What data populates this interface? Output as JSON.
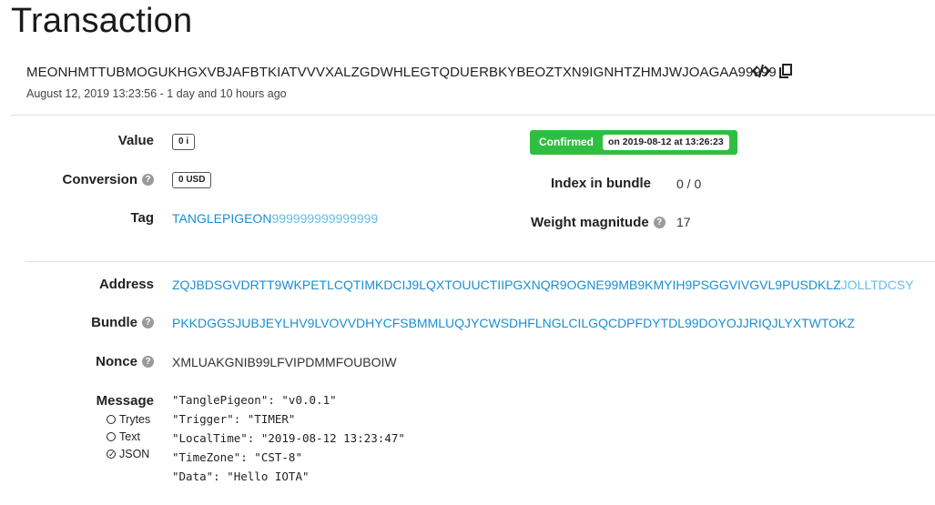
{
  "header": {
    "title": "Transaction",
    "hash": "MEONHMTTUBMOGUKHGXVBJAFBTKIATVVVXALZGDWHLEGTQDUERBKYBEOZTXN9IGNHTZHMJWJOAGAA99999",
    "date": "August 12, 2019 13:23:56 - 1 day and 10 hours ago",
    "icons": [
      "code-icon",
      "copy-icon"
    ]
  },
  "details": {
    "value_label": "Value",
    "value": "0 i",
    "conversion_label": "Conversion",
    "conversion": "0 USD",
    "tag_label": "Tag",
    "tag_main": "TANGLEPIGEON",
    "tag_suffix": "999999999999999",
    "status": "Confirmed",
    "status_time": "on 2019-08-12 at 13:26:23",
    "index_label": "Index in bundle",
    "index": "0 / 0",
    "weight_label": "Weight magnitude",
    "weight": "17"
  },
  "meta": {
    "address_label": "Address",
    "address_main": "ZQJBDSGVDRTT9WKPETLCQTIMKDCIJ9LQXTOUUCTIIPGXNQR9OGNE99MB9KMYIH9PSGGVIVGVL9PUSDKLZ",
    "address_checksum": "JOLLTDCSY",
    "bundle_label": "Bundle",
    "bundle": "PKKDGGSJUBJEYLHV9LVOVVDHYCFSBMMLUQJYCWSDHFLNGLCILGQCDPFDYTDL99DOYOJJRIQJLYXTWTOKZ",
    "nonce_label": "Nonce",
    "nonce": "XMLUAKGNIB99LFVIPDMMFOUBOIW",
    "message_label": "Message",
    "message_formats": [
      "Trytes",
      "Text",
      "JSON"
    ],
    "message_selected": "JSON",
    "message_lines": [
      "\"TanglePigeon\": \"v0.0.1\"",
      "\"Trigger\": \"TIMER\"",
      "\"LocalTime\": \"2019-08-12 13:23:47\"",
      "\"TimeZone\": \"CST-8\"",
      "\"Data\": \"Hello IOTA\""
    ]
  },
  "colors": {
    "link": "#1b8fd1",
    "link_light": "#63bde9",
    "confirmed": "#2fbf40"
  }
}
